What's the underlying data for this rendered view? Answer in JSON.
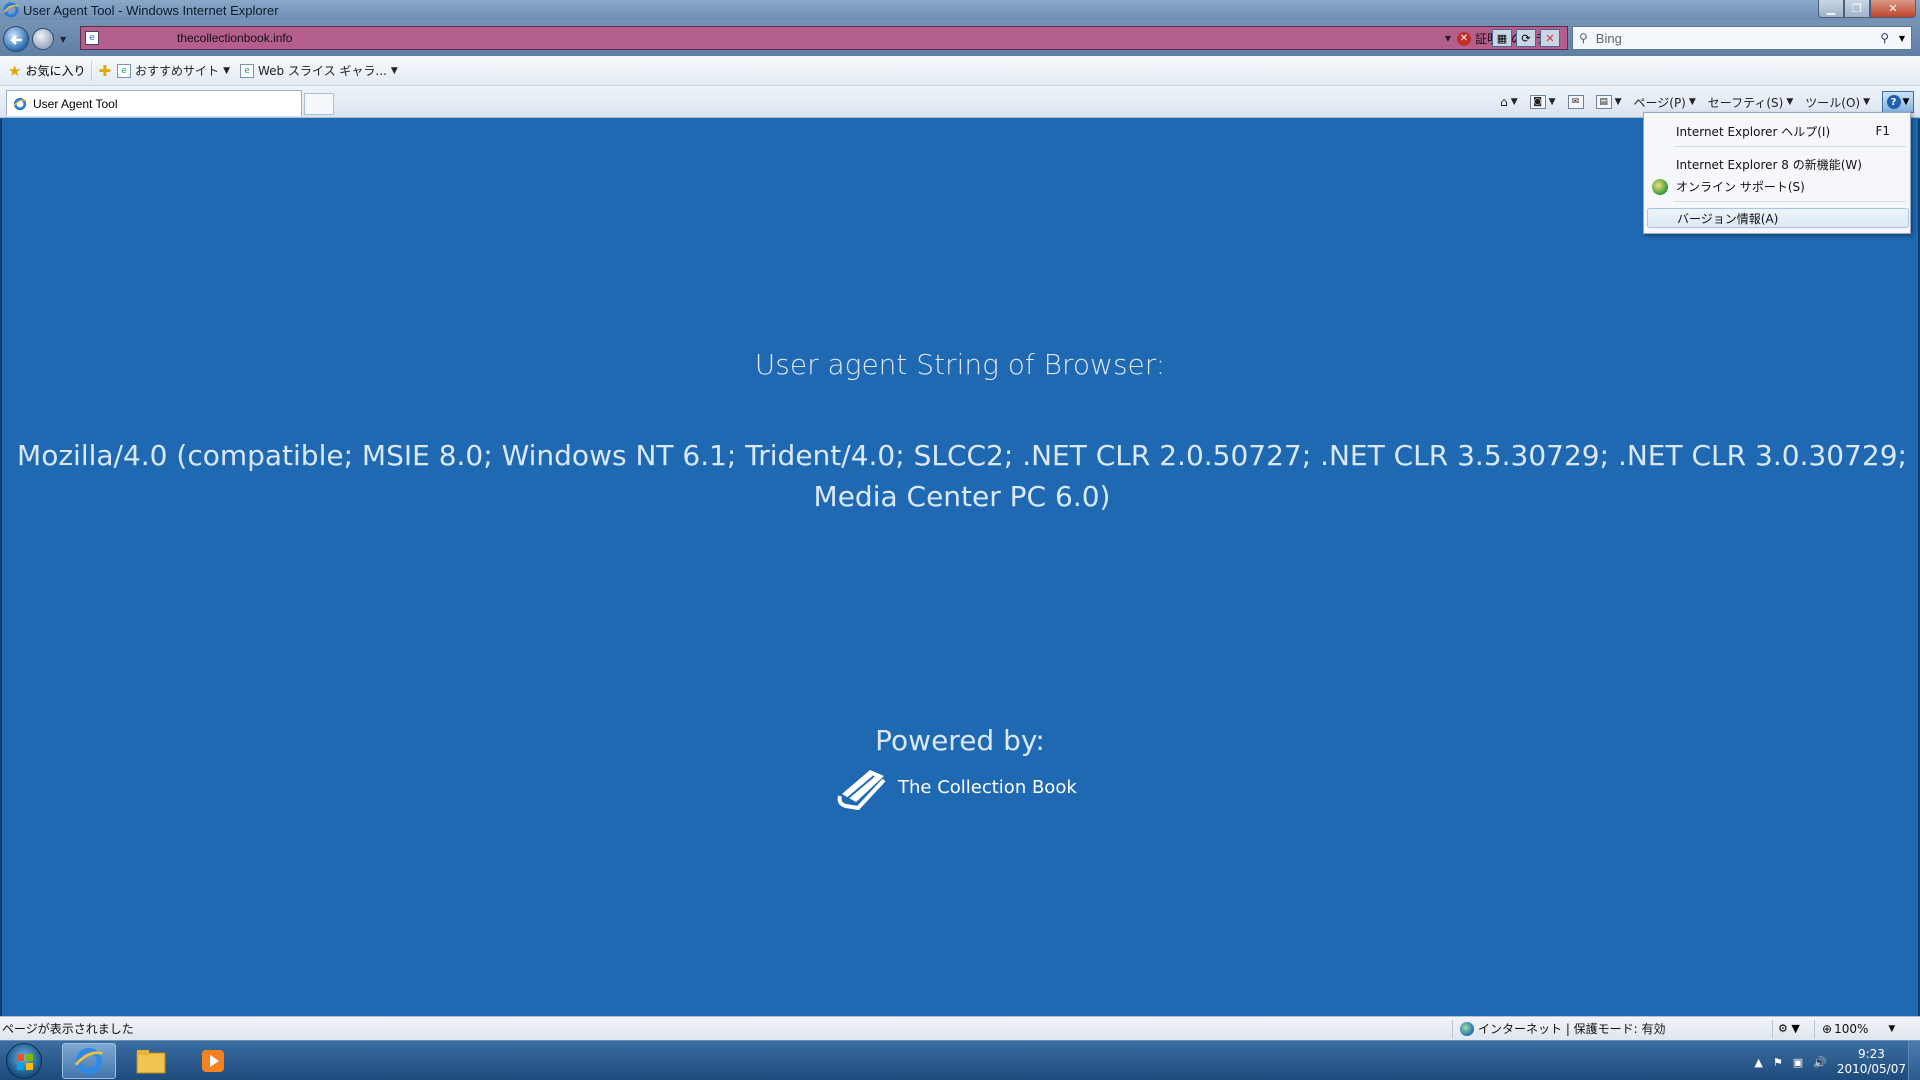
{
  "window": {
    "title": "User Agent Tool - Windows Internet Explorer"
  },
  "address_bar": {
    "url": "thecollectionbook.info",
    "cert_error": "証明書のエラー"
  },
  "search": {
    "placeholder": "Bing"
  },
  "favorites_bar": {
    "favorites_label": "お気に入り",
    "items": [
      {
        "label": "おすすめサイト"
      },
      {
        "label": "Web スライス ギャラ..."
      }
    ]
  },
  "tabs": [
    {
      "label": "User Agent Tool",
      "active": true
    }
  ],
  "command_bar": {
    "page_label": "ページ(P)",
    "safety_label": "セーフティ(S)",
    "tools_label": "ツール(O)"
  },
  "help_menu": {
    "items": [
      {
        "label": "Internet Explorer ヘルプ(I)",
        "shortcut": "F1"
      },
      {
        "label": "Internet Explorer 8 の新機能(W)"
      },
      {
        "label": "オンライン サポート(S)"
      },
      {
        "label": "バージョン情報(A)",
        "highlighted": true
      }
    ]
  },
  "page": {
    "ua_label": "User agent String of Browser:",
    "ua_string": "Mozilla/4.0 (compatible; MSIE 8.0; Windows NT 6.1; Trident/4.0; SLCC2; .NET CLR 2.0.50727; .NET CLR 3.5.30729; .NET CLR 3.0.30729; Media Center PC 6.0)",
    "powered_by": "Powered by:",
    "brand_name": "The Collection Book",
    "background_color": "#1f69b3"
  },
  "status_bar": {
    "status_text": "ページが表示されました",
    "zone_text": "インターネット | 保護モード: 有効",
    "zoom": "100%"
  },
  "taskbar": {
    "time": "9:23",
    "date": "2010/05/07"
  }
}
